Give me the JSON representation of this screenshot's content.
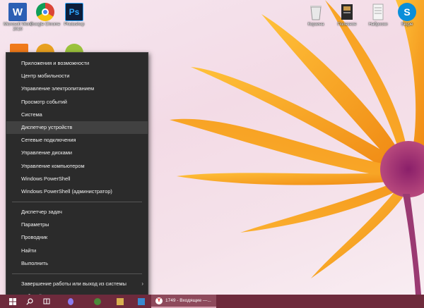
{
  "desktop_icons": [
    {
      "label": "Microsoft Word 2010",
      "icon": "word-icon",
      "color": "#2b5fb4",
      "glyph": "W"
    },
    {
      "label": "Google Chrome",
      "icon": "chrome-icon",
      "color": "#e04b33",
      "glyph": ""
    },
    {
      "label": "Photoshop",
      "icon": "photoshop-icon",
      "color": "#0d1e3a",
      "glyph": "Ps"
    },
    {
      "label": "Корзина",
      "icon": "recycle-bin-icon",
      "color": "#e8e8e8",
      "glyph": ""
    },
    {
      "label": "Полезное",
      "icon": "folder-icon",
      "color": "#2a2a2a",
      "glyph": ""
    },
    {
      "label": "Наброски",
      "icon": "notepad-icon",
      "color": "#f0f0f0",
      "glyph": ""
    },
    {
      "label": "Skype",
      "icon": "skype-icon",
      "color": "#0a8ed9",
      "glyph": "S"
    }
  ],
  "menu": {
    "items_group1": [
      "Приложения и возможности",
      "Центр мобильности",
      "Управление электропитанием",
      "Просмотр событий",
      "Система",
      "Диспетчер устройств",
      "Сетевые подключения",
      "Управление дисками",
      "Управление компьютером",
      "Windows PowerShell",
      "Windows PowerShell (администратор)"
    ],
    "items_group2": [
      "Диспетчер задач",
      "Параметры",
      "Проводник",
      "Найти",
      "Выполнить"
    ],
    "items_group3": [
      "Завершение работы или выход из системы",
      "Рабочий стол"
    ],
    "active_item": "Диспетчер устройств"
  },
  "taskbar": {
    "color": "#6e2a3c",
    "active_app_label": "1749 - Входящие —..."
  }
}
